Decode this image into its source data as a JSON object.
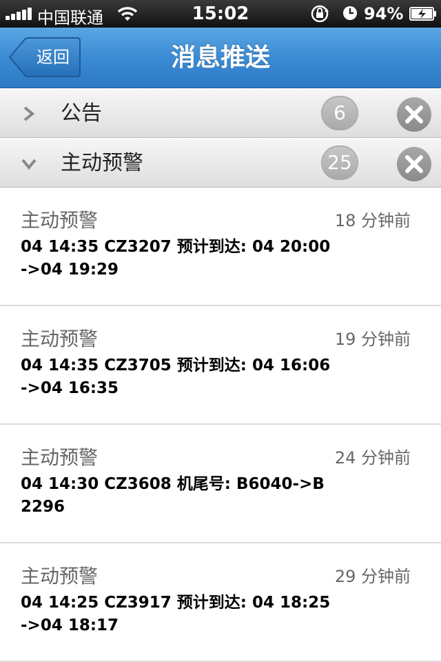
{
  "status_bar": {
    "carrier": "中国联通",
    "time": "15:02",
    "battery": "94%"
  },
  "nav": {
    "back_label": "返回",
    "title": "消息推送"
  },
  "sections": [
    {
      "label": "公告",
      "count": "6",
      "expanded": false
    },
    {
      "label": "主动预警",
      "count": "25",
      "expanded": true
    }
  ],
  "messages": [
    {
      "type": "主动预警",
      "time": "18 分钟前",
      "body": "04 14:35 CZ3207 预计到达: 04 20:00->04 19:29"
    },
    {
      "type": "主动预警",
      "time": "19 分钟前",
      "body": "04 14:35 CZ3705 预计到达: 04 16:06->04 16:35"
    },
    {
      "type": "主动预警",
      "time": "24 分钟前",
      "body": "04 14:30 CZ3608 机尾号: B6040->B2296"
    },
    {
      "type": "主动预警",
      "time": "29 分钟前",
      "body": "04 14:25 CZ3917 预计到达: 04 18:25->04 18:17"
    }
  ],
  "icons": {
    "signal": "signal-bars-icon",
    "wifi": "wifi-icon",
    "rotation_lock": "rotation-lock-icon",
    "alarm": "alarm-icon",
    "battery": "battery-charging-icon",
    "back": "back-arrow-icon",
    "collapsed": "chevron-right-icon",
    "expanded": "chevron-down-icon",
    "delete": "close-icon"
  },
  "colors": {
    "nav_blue": "#3b8bd4",
    "badge_gray": "#b5b5b5"
  }
}
